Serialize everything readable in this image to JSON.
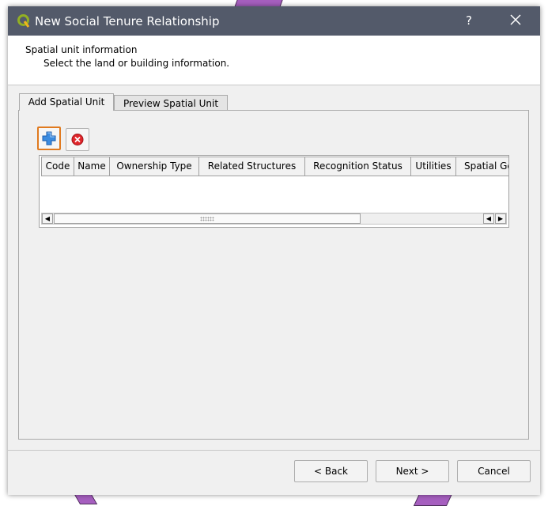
{
  "window": {
    "title": "New Social Tenure Relationship",
    "help_label": "?",
    "icons": {
      "app": "qgis-logo-icon",
      "close": "close-icon"
    }
  },
  "header": {
    "title": "Spatial unit information",
    "subtitle": "Select the land or building information."
  },
  "tabs": [
    {
      "label": "Add Spatial Unit",
      "active": true
    },
    {
      "label": "Preview Spatial Unit",
      "active": false
    }
  ],
  "toolbar": {
    "add_icon": "plus-icon",
    "remove_icon": "remove-red-x-icon"
  },
  "table": {
    "columns": [
      "Code",
      "Name",
      "Ownership Type",
      "Related Structures",
      "Recognition Status",
      "Utilities",
      "Spatial Ge"
    ],
    "rows": []
  },
  "buttons": {
    "back": "< Back",
    "next": "Next >",
    "cancel": "Cancel"
  }
}
